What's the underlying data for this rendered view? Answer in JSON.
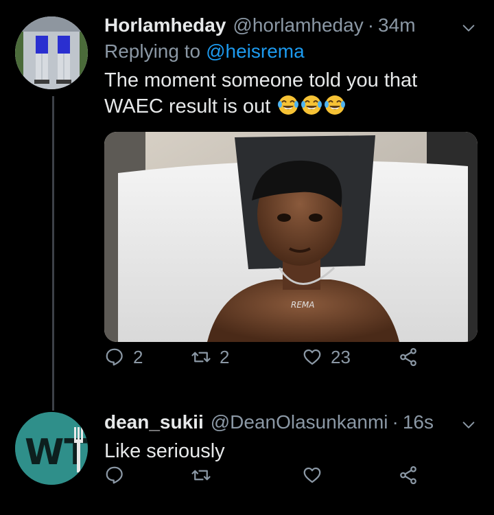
{
  "colors": {
    "background": "#000000",
    "text": "#e7e9ea",
    "muted": "#8b98a5",
    "link": "#1d9bf0"
  },
  "tweets": [
    {
      "display_name": "Horlamheday",
      "handle": "@horlamheday",
      "separator": "·",
      "time": "34m",
      "replying_prefix": "Replying to",
      "replying_to": "@heisrema",
      "text_line1": "The moment someone told you that",
      "text_line2": "WAEC result is out",
      "emoji": "face-with-tears-of-joy x3",
      "image_caption": "REMA",
      "replies": "2",
      "retweets": "2",
      "likes": "23",
      "icons": [
        "reply-icon",
        "retweet-icon",
        "like-icon",
        "share-icon",
        "chevron-down-icon"
      ]
    },
    {
      "display_name": "dean_sukii",
      "handle": "@DeanOlasunkanmi",
      "separator": "·",
      "time": "16s",
      "text": "Like seriously",
      "avatar_text": "WT",
      "replies": "",
      "retweets": "",
      "likes": "",
      "icons": [
        "reply-icon",
        "retweet-icon",
        "like-icon",
        "share-icon",
        "chevron-down-icon"
      ]
    }
  ]
}
